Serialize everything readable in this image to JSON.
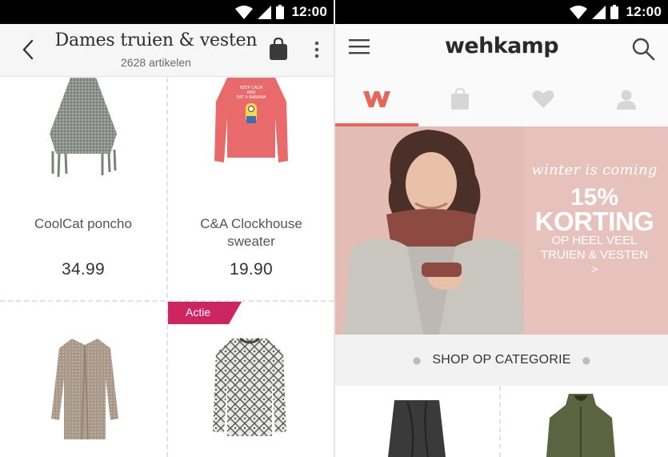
{
  "statusbar": {
    "time": "12:00"
  },
  "left": {
    "title": "Dames truien & vesten",
    "subtitle": "2628 artikelen",
    "icons": {
      "back": "back-arrow-icon",
      "bag": "shopping-bag-icon",
      "more": "more-vert-icon"
    },
    "products": [
      {
        "name": "CoolCat poncho",
        "price": "34.99"
      },
      {
        "name": "C&A Clockhouse sweater",
        "price": "19.90"
      },
      {
        "name": "",
        "price": ""
      },
      {
        "name": "",
        "price": "",
        "badge": "Actie"
      }
    ]
  },
  "right": {
    "logo": "wehkamp",
    "icons": {
      "menu": "hamburger-menu-icon",
      "search": "search-icon"
    },
    "tabs": [
      {
        "icon": "wehkamp-w-icon",
        "active": true
      },
      {
        "icon": "shopping-bag-icon",
        "active": false
      },
      {
        "icon": "heart-icon",
        "active": false
      },
      {
        "icon": "user-icon",
        "active": false
      }
    ],
    "banner": {
      "line1": "winter is coming",
      "line2": "15%",
      "line3": "KORTING",
      "line4": "OP HEEL VEEL",
      "line5": "TRUIEN & VESTEN",
      "line6": ">"
    },
    "category_title": "SHOP OP CATEGORIE"
  },
  "colors": {
    "accent": "#e5675a",
    "badge": "#cc2560",
    "banner_bg": "#e7c2bd",
    "statusbar": "#000000"
  }
}
